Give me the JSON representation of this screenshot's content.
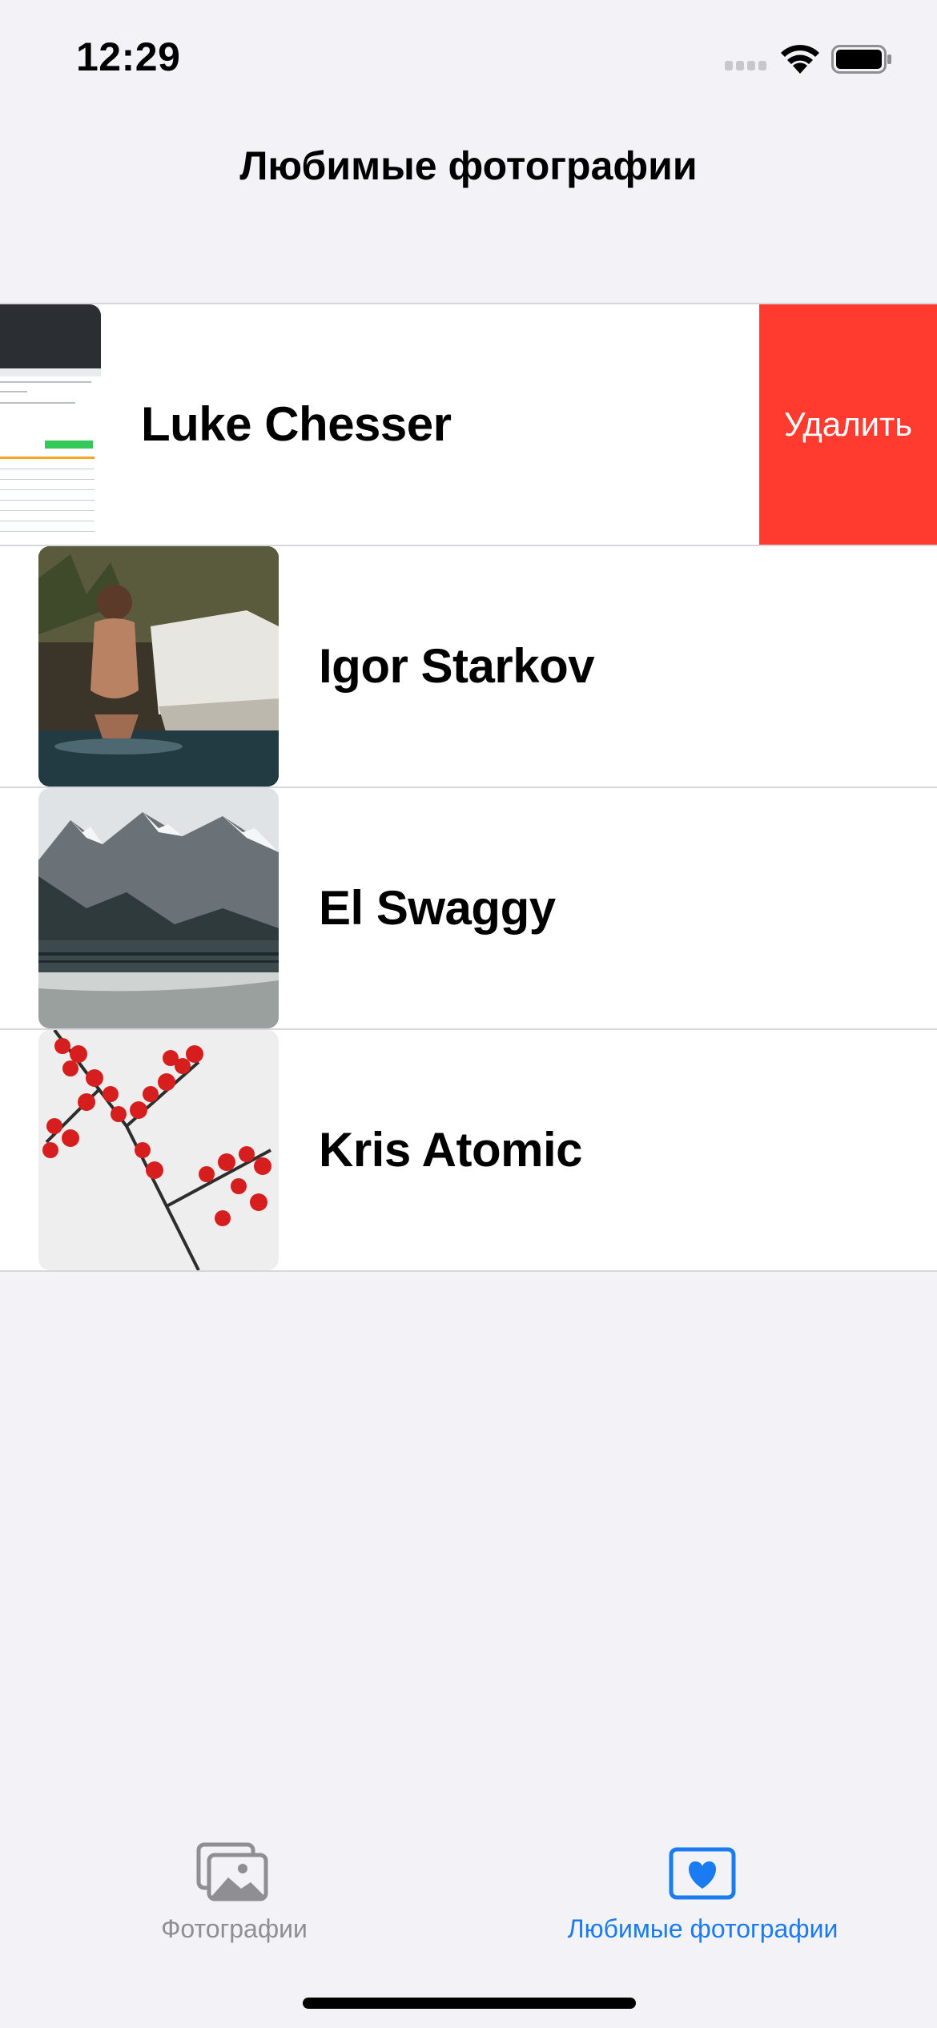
{
  "status_bar": {
    "time": "12:29"
  },
  "nav": {
    "title": "Любимые фотографии"
  },
  "list": {
    "rows": [
      {
        "title": "Luke Chesser",
        "swiped": true,
        "action": "Удалить"
      },
      {
        "title": "Igor Starkov"
      },
      {
        "title": "El Swaggy"
      },
      {
        "title": "Kris Atomic"
      }
    ]
  },
  "tab_bar": {
    "tabs": [
      {
        "label": "Фотографии",
        "icon": "photos-icon",
        "selected": false
      },
      {
        "label": "Любимые фотографии",
        "icon": "heart-icon",
        "selected": true
      }
    ]
  },
  "colors": {
    "accent": "#1a7cf0",
    "delete": "#ff3b30",
    "inactive": "#8e8e93",
    "background": "#f2f2f7"
  }
}
